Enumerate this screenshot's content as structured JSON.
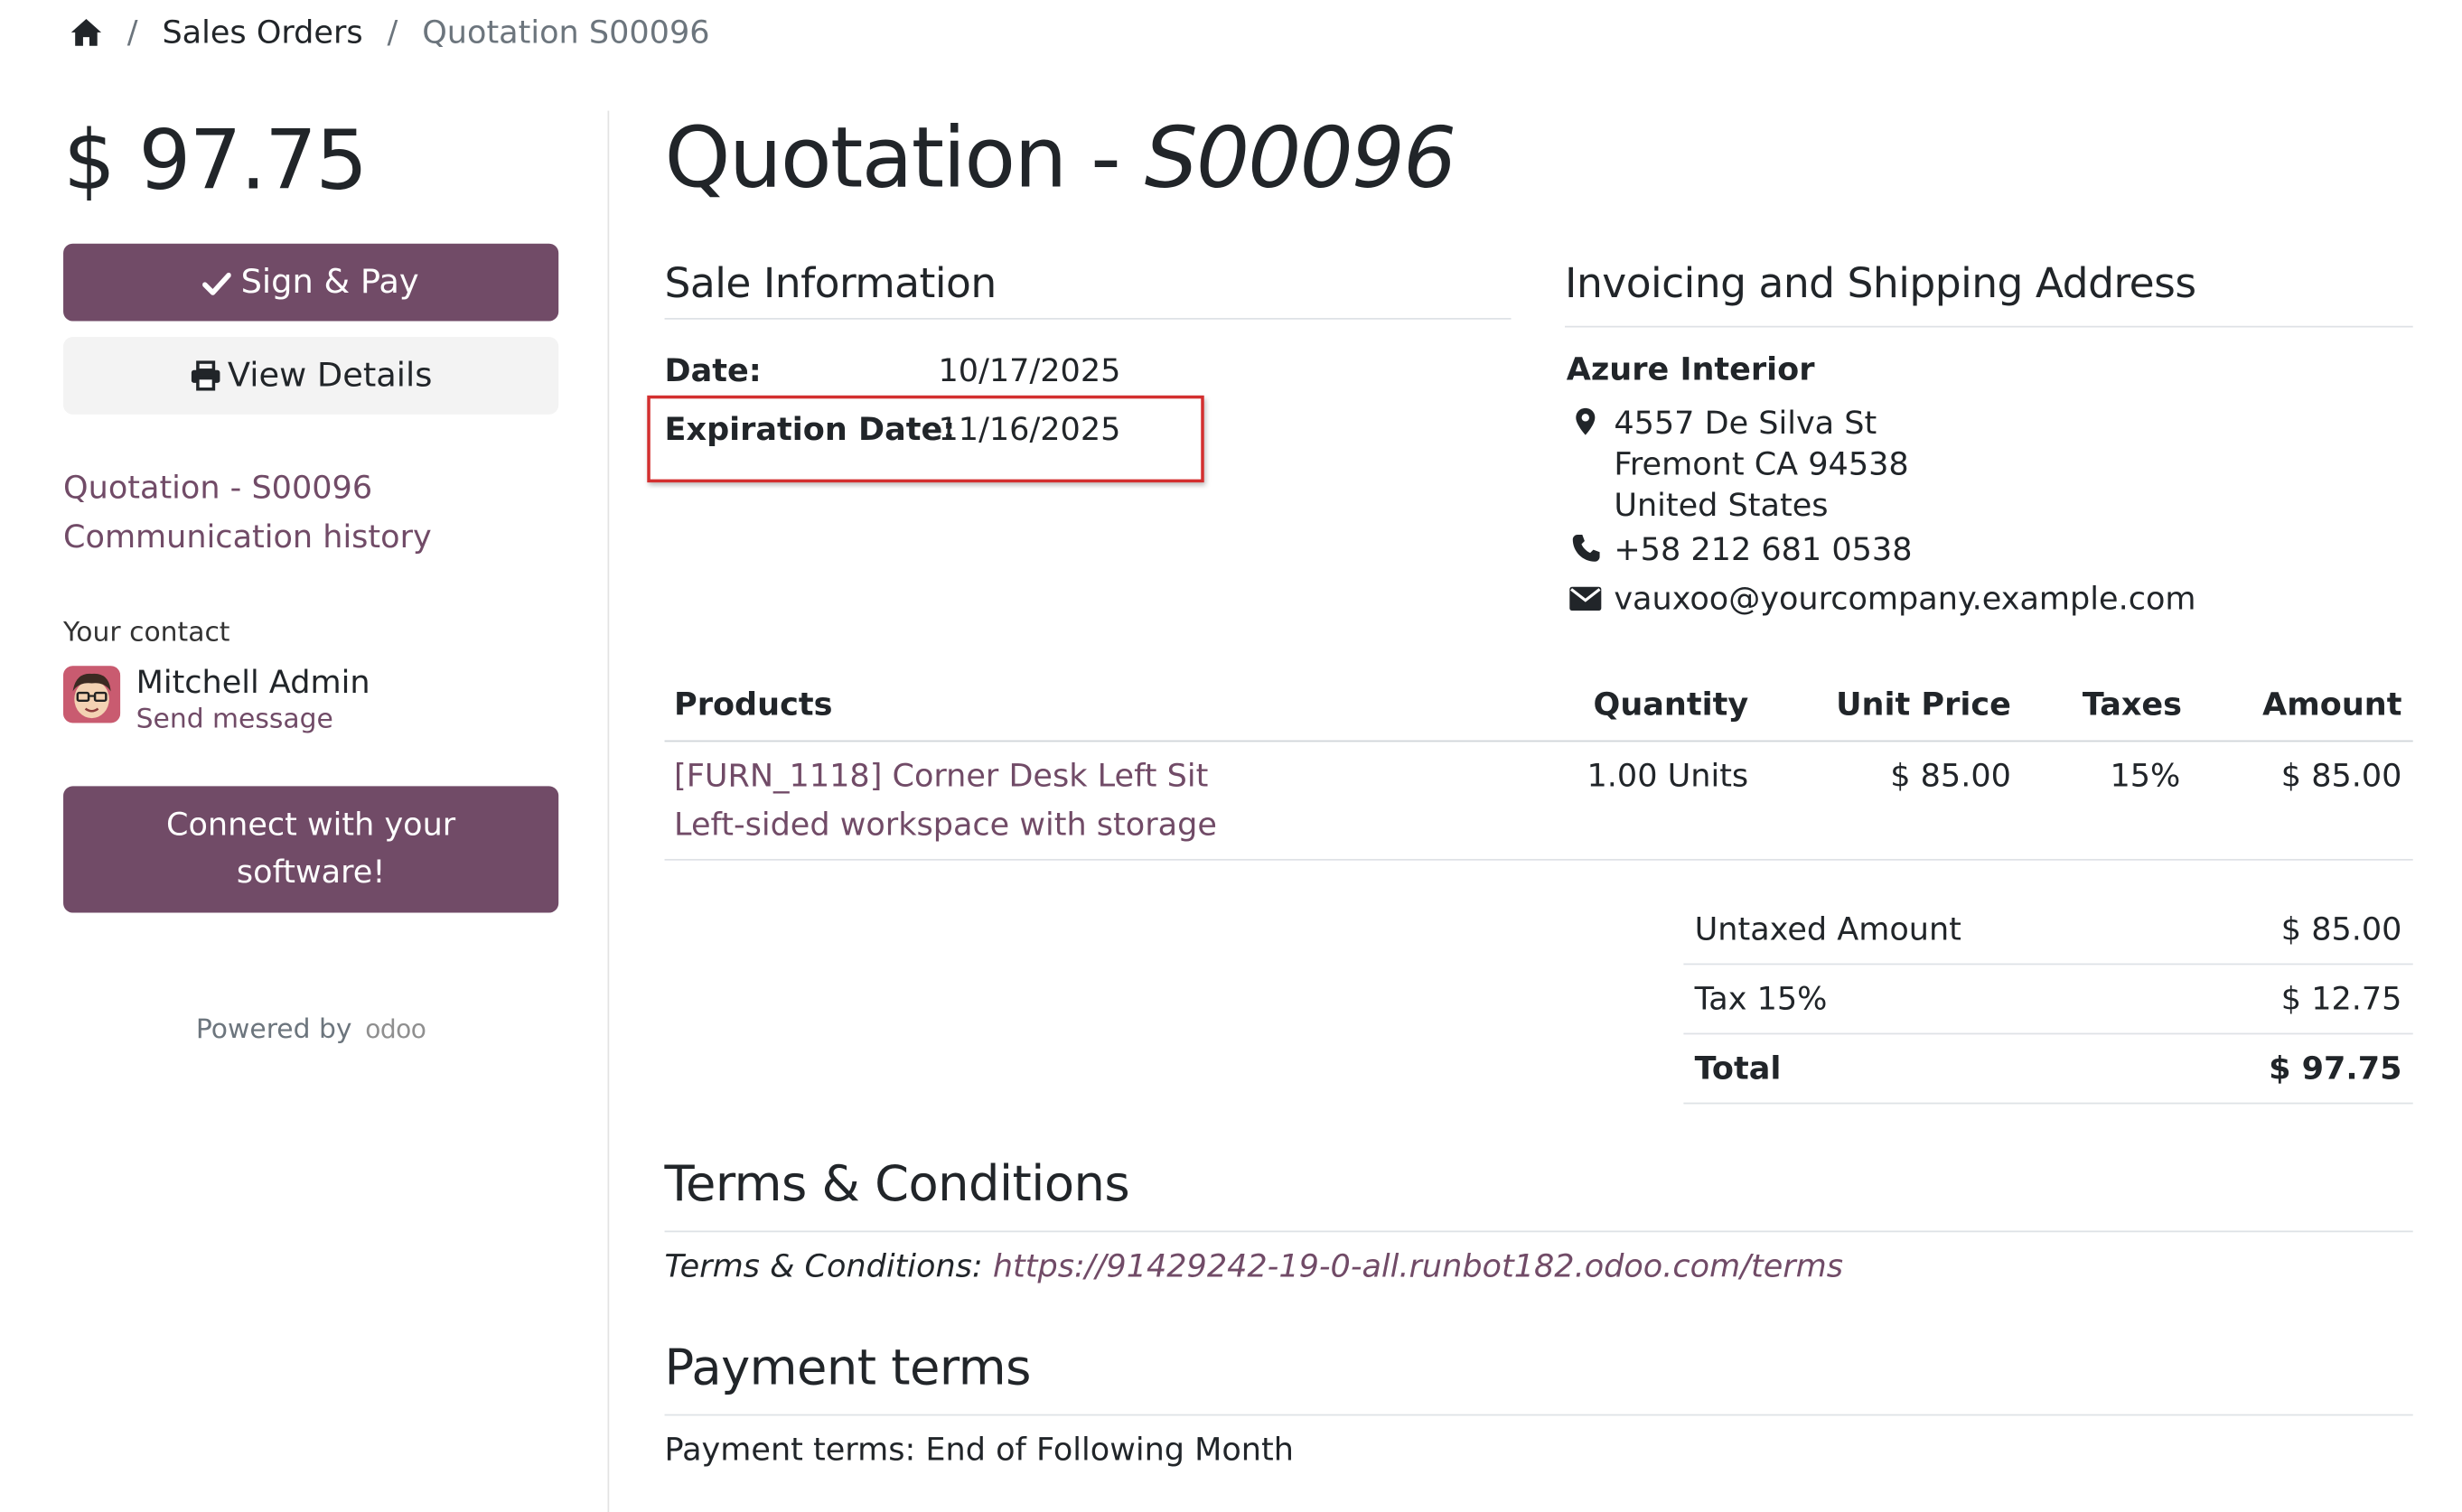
{
  "breadcrumb": {
    "home_icon": "home-icon",
    "separator": "/",
    "items": [
      "Sales Orders",
      "Quotation S00096"
    ]
  },
  "sidebar": {
    "amount": "$ 97.75",
    "sign_pay_label": "Sign & Pay",
    "sign_pay_icon": "check-icon",
    "view_details_label": "View Details",
    "view_details_icon": "print-icon",
    "links": [
      "Quotation - S00096",
      "Communication history"
    ],
    "contact_heading": "Your contact",
    "contact_name": "Mitchell Admin",
    "send_message": "Send message",
    "connect_button": [
      "Connect with your",
      "software!"
    ],
    "powered_by": "Powered by",
    "brand": "odoo"
  },
  "main": {
    "title_prefix": "Quotation - ",
    "title_number": "S00096",
    "sale_info": {
      "heading": "Sale Information",
      "date_label": "Date:",
      "date_value": "10/17/2025",
      "expiration_label": "Expiration Date:",
      "expiration_value": "11/16/2025"
    },
    "address": {
      "heading": "Invoicing and Shipping Address",
      "company": "Azure Interior",
      "street": "4557 De Silva St",
      "city": "Fremont CA 94538",
      "country": "United States",
      "phone": "+58 212 681 0538",
      "email": "vauxoo@yourcompany.example.com"
    },
    "table": {
      "headers": [
        "Products",
        "Quantity",
        "Unit Price",
        "Taxes",
        "Amount"
      ],
      "rows": [
        {
          "product": "[FURN_1118] Corner Desk Left Sit",
          "description": "Left-sided workspace with storage",
          "quantity": "1.00 Units",
          "unit_price": "$ 85.00",
          "taxes": "15%",
          "amount": "$ 85.00"
        }
      ]
    },
    "totals": [
      {
        "label": "Untaxed Amount",
        "value": "$ 85.00"
      },
      {
        "label": "Tax 15%",
        "value": "$ 12.75"
      },
      {
        "label": "Total",
        "value": "$ 97.75"
      }
    ],
    "terms": {
      "heading": "Terms & Conditions",
      "label": "Terms & Conditions:",
      "url": "https://91429242-19-0-all.runbot182.odoo.com/terms"
    },
    "payment_terms": {
      "heading": "Payment terms",
      "text": "Payment terms: End of Following Month"
    }
  },
  "colors": {
    "brand": "#714b67",
    "highlight": "#d32f2f"
  }
}
